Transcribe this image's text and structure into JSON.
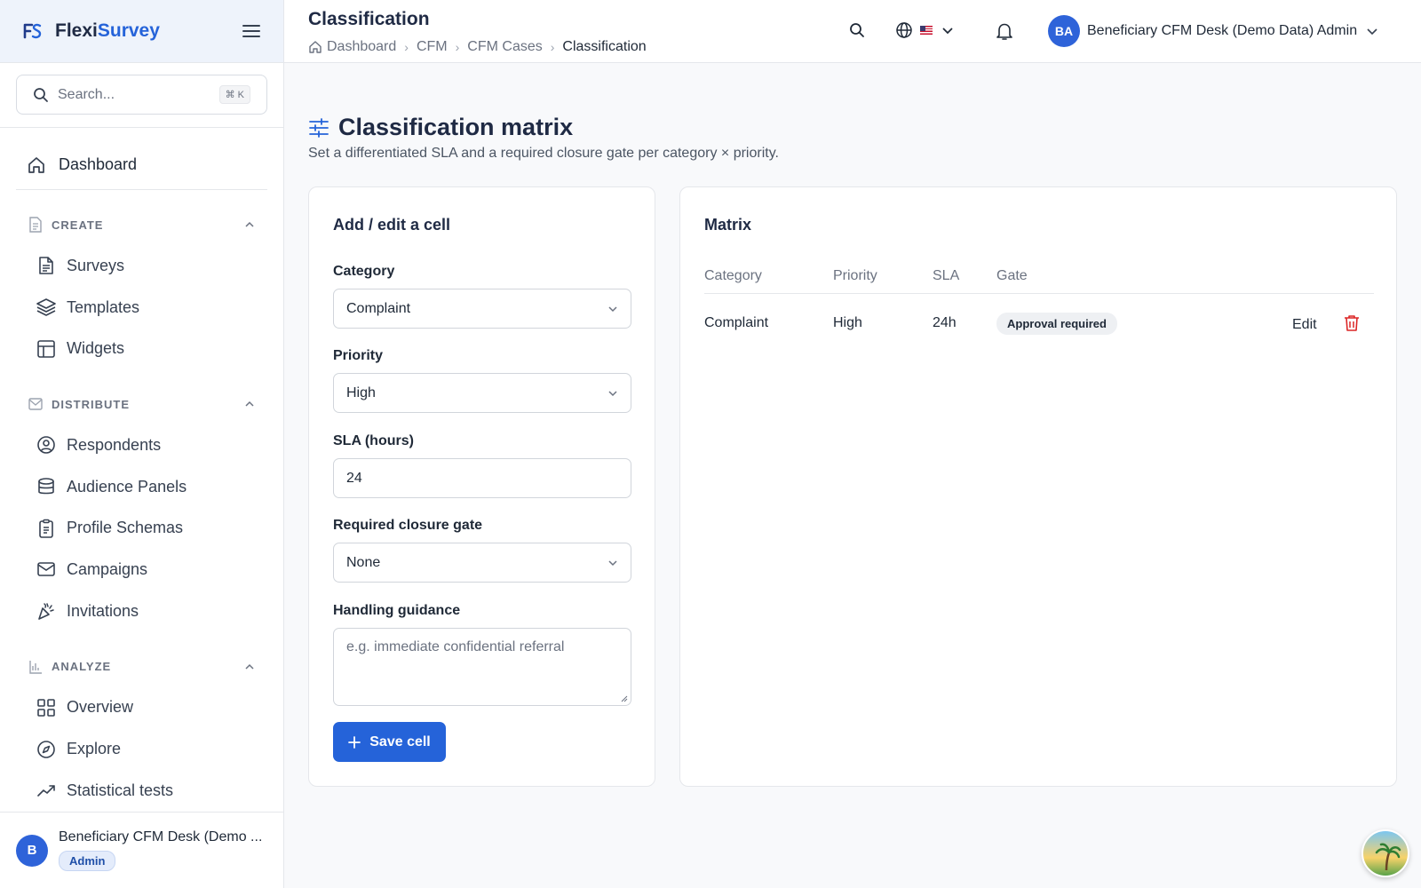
{
  "brand": {
    "prefix": "Flexi",
    "suffix": "Survey"
  },
  "search": {
    "placeholder": "Search...",
    "shortcut": "⌘ K"
  },
  "sidebar": {
    "dashboard": "Dashboard",
    "sections": [
      {
        "title": "CREATE",
        "items": [
          "Surveys",
          "Templates",
          "Widgets"
        ]
      },
      {
        "title": "DISTRIBUTE",
        "items": [
          "Respondents",
          "Audience Panels",
          "Profile Schemas",
          "Campaigns",
          "Invitations"
        ]
      },
      {
        "title": "ANALYZE",
        "items": [
          "Overview",
          "Explore",
          "Statistical tests"
        ]
      }
    ],
    "footer": {
      "avatar": "B",
      "name": "Beneficiary CFM Desk (Demo ...",
      "role": "Admin"
    }
  },
  "header": {
    "title": "Classification",
    "breadcrumb": [
      "Dashboard",
      "CFM",
      "CFM Cases",
      "Classification"
    ],
    "user": {
      "initials": "BA",
      "name": "Beneficiary CFM Desk (Demo Data) Admin"
    }
  },
  "main": {
    "title": "Classification matrix",
    "subtitle": "Set a differentiated SLA and a required closure gate per category × priority."
  },
  "form": {
    "title": "Add / edit a cell",
    "category_label": "Category",
    "category_value": "Complaint",
    "priority_label": "Priority",
    "priority_value": "High",
    "sla_label": "SLA (hours)",
    "sla_value": "24",
    "gate_label": "Required closure gate",
    "gate_value": "None",
    "guidance_label": "Handling guidance",
    "guidance_placeholder": "e.g. immediate confidential referral",
    "save_label": "Save cell"
  },
  "matrix": {
    "title": "Matrix",
    "columns": [
      "Category",
      "Priority",
      "SLA",
      "Gate"
    ],
    "rows": [
      {
        "category": "Complaint",
        "priority": "High",
        "sla": "24h",
        "gate": "Approval required",
        "edit": "Edit"
      }
    ]
  },
  "colors": {
    "primary": "#2563d9",
    "delete": "#dc2626",
    "sidebar_brand_bg": "#eef3fb"
  }
}
